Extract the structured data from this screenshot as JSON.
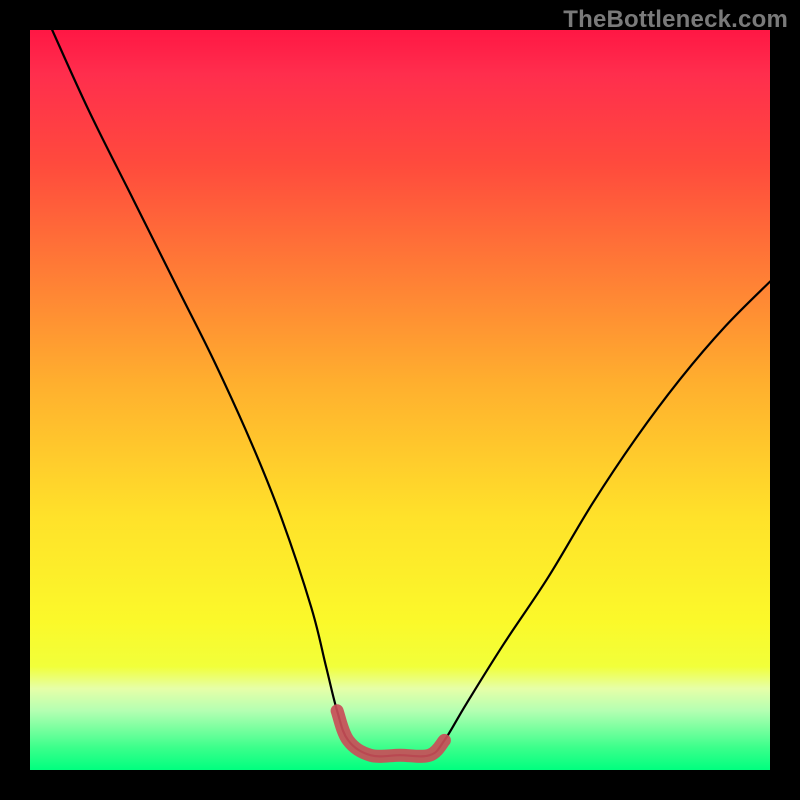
{
  "watermark": "TheBottleneck.com",
  "colors": {
    "frame": "#000000",
    "curve": "#000000",
    "highlight": "#c94e58",
    "watermark_text": "#7a7a7a"
  },
  "chart_data": {
    "type": "line",
    "title": "",
    "xlabel": "",
    "ylabel": "",
    "xlim": [
      0,
      100
    ],
    "ylim": [
      0,
      100
    ],
    "grid": false,
    "legend": false,
    "series": [
      {
        "name": "bottleneck-curve",
        "x": [
          3,
          8,
          14,
          20,
          25,
          30,
          34,
          38,
          40,
          41.5,
          43,
          46,
          50,
          54,
          56,
          59,
          64,
          70,
          76,
          82,
          88,
          94,
          100
        ],
        "y": [
          100,
          89,
          77,
          65,
          55,
          44,
          34,
          22,
          14,
          8,
          4,
          2,
          2,
          2,
          4,
          9,
          17,
          26,
          36,
          45,
          53,
          60,
          66
        ]
      }
    ],
    "highlight_segment": {
      "description": "flat valley region emphasized in red along the curve bottom",
      "x_start": 41.5,
      "x_end": 56
    },
    "background_gradient_meaning": "red (top) = high bottleneck, green (bottom) = low bottleneck"
  }
}
